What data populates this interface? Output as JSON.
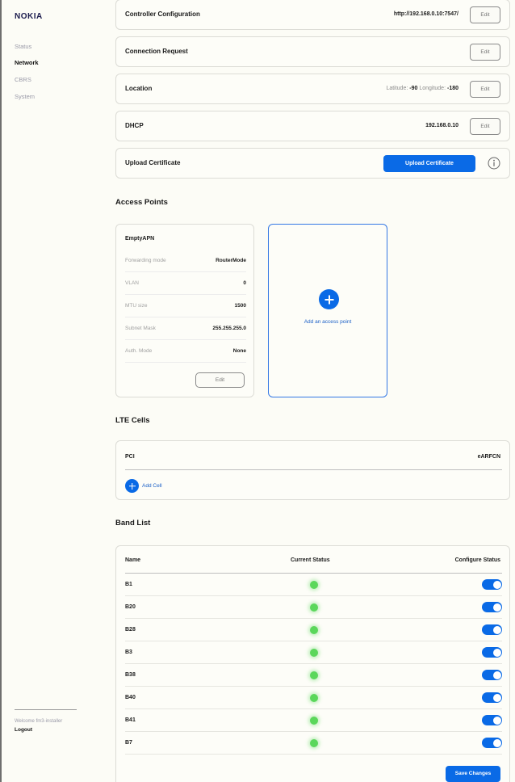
{
  "sidebar": {
    "logo": "NOKIA",
    "nav": [
      "Status",
      "Network",
      "CBRS",
      "System"
    ],
    "active": "Network",
    "welcome": "Welcome fm3-installer",
    "logout": "Logout"
  },
  "settings": [
    {
      "title": "Controller Configuration",
      "value": "http://192.168.0.10:7547/",
      "edit": "Edit"
    },
    {
      "title": "Connection Request",
      "value": "",
      "edit": "Edit"
    },
    {
      "title": "Location",
      "lat_label": "Latitude:",
      "lat": "-90",
      "lon_label": "Longitude:",
      "lon": "-180",
      "edit": "Edit"
    },
    {
      "title": "DHCP",
      "value": "192.168.0.10",
      "edit": "Edit"
    },
    {
      "title": "Upload Certificate",
      "button": "Upload Certificate",
      "icon": "info-icon"
    }
  ],
  "access_points": {
    "title": "Access Points",
    "apn": {
      "name": "EmptyAPN",
      "fields": [
        {
          "label": "Forwarding mode",
          "value": "RouterMode"
        },
        {
          "label": "VLAN",
          "value": "0"
        },
        {
          "label": "MTU size",
          "value": "1500"
        },
        {
          "label": "Subnet Mask",
          "value": "255.255.255.0"
        },
        {
          "label": "Auth. Mode",
          "value": "None"
        }
      ],
      "edit": "Edit"
    },
    "add_label": "Add an access point"
  },
  "lte_cells": {
    "title": "LTE Cells",
    "col_pci": "PCI",
    "col_earfcn": "eARFCN",
    "add_label": "Add Cell"
  },
  "band_list": {
    "title": "Band List",
    "col_name": "Name",
    "col_current": "Current Status",
    "col_configure": "Configure Status",
    "bands": [
      {
        "name": "B1",
        "status_color": "#5bd75b",
        "enabled": true
      },
      {
        "name": "B20",
        "status_color": "#5bd75b",
        "enabled": true
      },
      {
        "name": "B28",
        "status_color": "#5bd75b",
        "enabled": true
      },
      {
        "name": "B3",
        "status_color": "#5bd75b",
        "enabled": true
      },
      {
        "name": "B38",
        "status_color": "#5bd75b",
        "enabled": true
      },
      {
        "name": "B40",
        "status_color": "#5bd75b",
        "enabled": true
      },
      {
        "name": "B41",
        "status_color": "#5bd75b",
        "enabled": true
      },
      {
        "name": "B7",
        "status_color": "#5bd75b",
        "enabled": true
      }
    ],
    "save": "Save Changes"
  },
  "colors": {
    "accent": "#0a6ae6",
    "status_ok": "#5bd75b"
  }
}
